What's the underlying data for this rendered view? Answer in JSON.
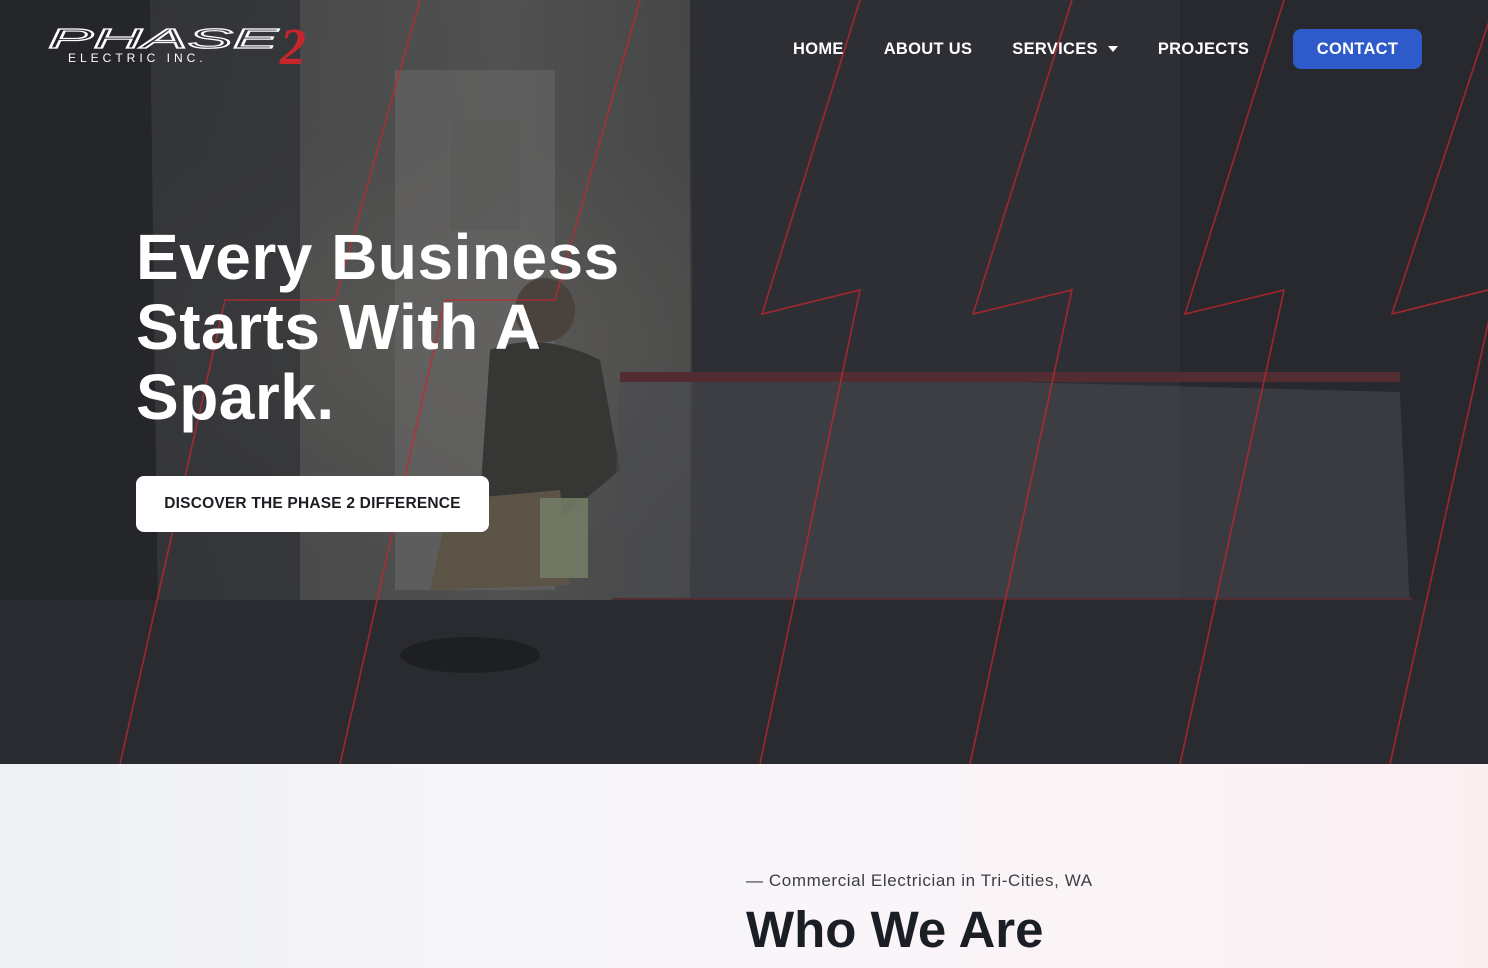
{
  "brand": {
    "name_line1": "PHASE",
    "name_line2": "ELECTRIC INC.",
    "numeral": "2",
    "accent_color": "#c8262d"
  },
  "nav": {
    "items": [
      {
        "label": "HOME"
      },
      {
        "label": "ABOUT US"
      },
      {
        "label": "SERVICES",
        "has_dropdown": true
      },
      {
        "label": "PROJECTS"
      }
    ],
    "contact_label": "CONTACT",
    "contact_color": "#2e5bc9"
  },
  "hero": {
    "headline": "Every Business Starts With A Spark.",
    "cta_label": "DISCOVER THE PHASE 2 DIFFERENCE"
  },
  "about": {
    "eyebrow": "— Commercial Electrician in Tri-Cities, WA",
    "title": "Who We Are"
  },
  "icons": [
    "dropdown-caret-icon"
  ]
}
